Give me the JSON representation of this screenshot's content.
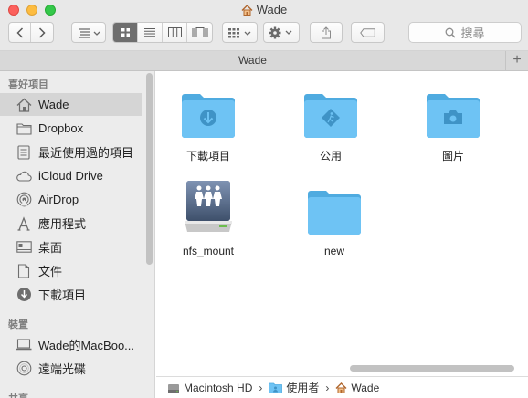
{
  "window": {
    "title": "Wade"
  },
  "toolbar": {
    "search_label": "搜尋"
  },
  "tabbar": {
    "tab_label": "Wade",
    "add_label": "+"
  },
  "sidebar": {
    "favorites_title": "喜好項目",
    "favorites": [
      {
        "label": "Wade",
        "icon": "home-icon",
        "selected": true
      },
      {
        "label": "Dropbox",
        "icon": "folder-icon"
      },
      {
        "label": "最近使用過的項目",
        "icon": "recents-icon"
      },
      {
        "label": "iCloud Drive",
        "icon": "cloud-icon"
      },
      {
        "label": "AirDrop",
        "icon": "airdrop-icon"
      },
      {
        "label": "應用程式",
        "icon": "applications-icon"
      },
      {
        "label": "桌面",
        "icon": "desktop-icon"
      },
      {
        "label": "文件",
        "icon": "documents-icon"
      },
      {
        "label": "下載項目",
        "icon": "downloads-icon"
      }
    ],
    "devices_title": "裝置",
    "devices": [
      {
        "label": "Wade的MacBoo...",
        "icon": "laptop-icon"
      },
      {
        "label": "遠端光碟",
        "icon": "disc-icon"
      }
    ],
    "shared_title": "共享"
  },
  "files": [
    {
      "name": "下載項目",
      "icon": "downloads-folder-icon"
    },
    {
      "name": "公用",
      "icon": "public-folder-icon"
    },
    {
      "name": "圖片",
      "icon": "pictures-folder-icon"
    },
    {
      "name": "nfs_mount",
      "icon": "network-volume-icon"
    },
    {
      "name": "new",
      "icon": "folder-icon"
    }
  ],
  "pathbar": {
    "items": [
      {
        "label": "Macintosh HD",
        "icon": "hard-drive-icon"
      },
      {
        "label": "使用者",
        "icon": "users-folder-icon"
      },
      {
        "label": "Wade",
        "icon": "home-icon"
      }
    ],
    "separator": "›"
  },
  "colors": {
    "folder_blue": "#6ec3f4",
    "folder_blue_dark": "#4fabe0",
    "sidebar_bg": "#ececec",
    "selected_bg": "#d5d5d5"
  }
}
